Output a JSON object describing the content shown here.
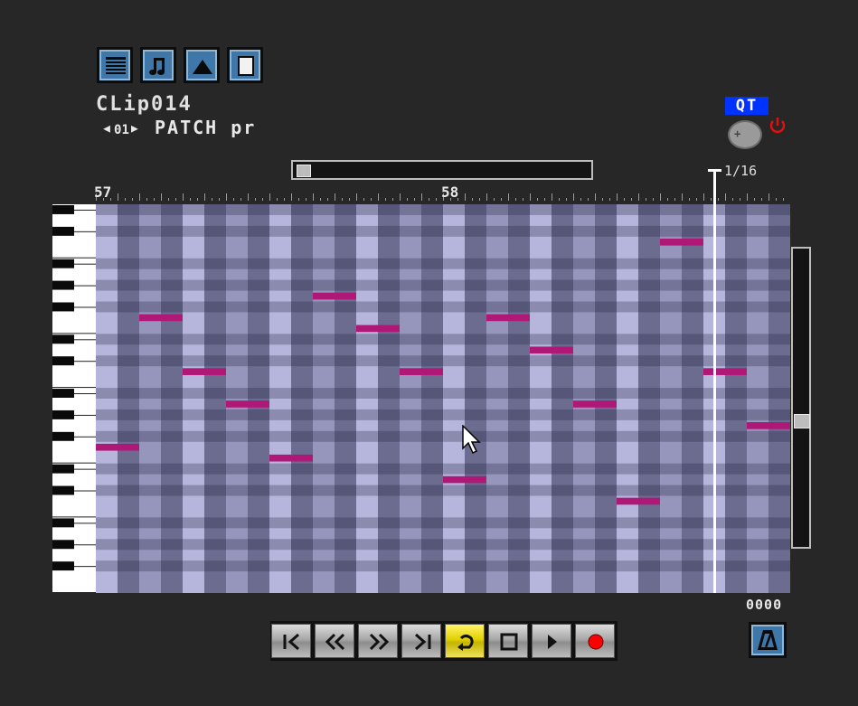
{
  "toolbar": {
    "tools": [
      {
        "name": "list-editor-icon"
      },
      {
        "name": "score-editor-icon"
      },
      {
        "name": "automation-editor-icon"
      },
      {
        "name": "clip-properties-icon"
      }
    ]
  },
  "clip": {
    "name": "CLip014",
    "channel": "01",
    "patch": "PATCH pr"
  },
  "quantize": {
    "qt_label": "QT",
    "grid_label": "1/16"
  },
  "ruler": {
    "bars": [
      "57",
      "58"
    ]
  },
  "counter": "0000",
  "transport": {
    "buttons": [
      {
        "name": "go-to-start-button",
        "icon": "skip-start-icon",
        "active": false
      },
      {
        "name": "rewind-button",
        "icon": "rewind-icon",
        "active": false
      },
      {
        "name": "fast-forward-button",
        "icon": "fast-forward-icon",
        "active": false
      },
      {
        "name": "go-to-end-button",
        "icon": "skip-end-icon",
        "active": false
      },
      {
        "name": "loop-button",
        "icon": "loop-icon",
        "active": true
      },
      {
        "name": "stop-button",
        "icon": "stop-icon",
        "active": false
      },
      {
        "name": "play-button",
        "icon": "play-icon",
        "active": false
      },
      {
        "name": "record-button",
        "icon": "record-icon",
        "active": false
      }
    ]
  },
  "piano_roll": {
    "visible_steps": 32,
    "visible_rows": 36,
    "notes": [
      {
        "step": 0,
        "row": 22
      },
      {
        "step": 2,
        "row": 10
      },
      {
        "step": 4,
        "row": 15
      },
      {
        "step": 6,
        "row": 18
      },
      {
        "step": 8,
        "row": 23
      },
      {
        "step": 10,
        "row": 8
      },
      {
        "step": 12,
        "row": 11
      },
      {
        "step": 14,
        "row": 15
      },
      {
        "step": 16,
        "row": 25
      },
      {
        "step": 18,
        "row": 10
      },
      {
        "step": 20,
        "row": 13
      },
      {
        "step": 22,
        "row": 18
      },
      {
        "step": 24,
        "row": 27
      },
      {
        "step": 26,
        "row": 3
      },
      {
        "step": 28,
        "row": 15
      },
      {
        "step": 30,
        "row": 20
      }
    ],
    "note_color": "#b01878",
    "playhead_step": 28.5
  },
  "colors": {
    "background": "#272727",
    "accent_blue": "#3f77a8",
    "qt_badge": "#0033ff",
    "power_red": "#e01010",
    "loop_active": "#e2d100",
    "record_red": "#ff0000"
  }
}
